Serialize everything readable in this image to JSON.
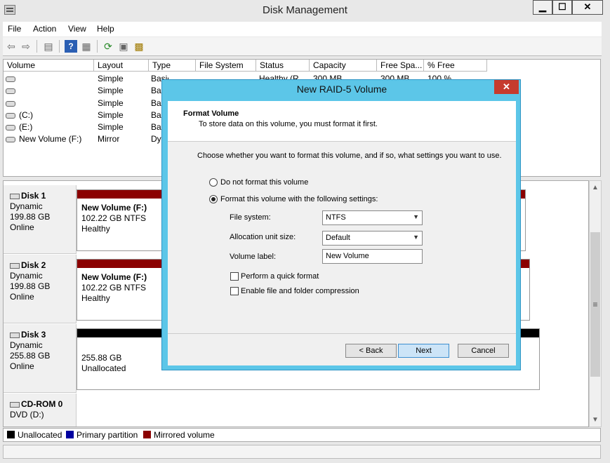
{
  "window": {
    "title": "Disk Management",
    "minimize": "▁",
    "maximize": "☐",
    "close": "✕"
  },
  "menu": [
    "File",
    "Action",
    "View",
    "Help"
  ],
  "volume_table": {
    "columns": [
      "Volume",
      "Layout",
      "Type",
      "File System",
      "Status",
      "Capacity",
      "Free Spa...",
      "% Free"
    ],
    "first_row": {
      "type": "Basic",
      "status": "Healthy (R...",
      "capacity": "300 MB",
      "free": "300 MB",
      "pct": "100 %"
    },
    "rows": [
      {
        "volume": "",
        "layout": "Simple",
        "type": "Ba"
      },
      {
        "volume": "",
        "layout": "Simple",
        "type": "Ba"
      },
      {
        "volume": "(C:)",
        "layout": "Simple",
        "type": "Ba"
      },
      {
        "volume": "(E:)",
        "layout": "Simple",
        "type": "Ba"
      },
      {
        "volume": "New Volume (F:)",
        "layout": "Mirror",
        "type": "Dy"
      },
      {
        "volume": "",
        "layout": "Simple",
        "type": "Basic"
      }
    ]
  },
  "disks": [
    {
      "name": "Disk 1",
      "kind": "Dynamic",
      "size": "199.88 GB",
      "state": "Online",
      "partition": {
        "name": "New Volume  (F:)",
        "size": "102.22 GB NTFS",
        "status": "Healthy"
      }
    },
    {
      "name": "Disk 2",
      "kind": "Dynamic",
      "size": "199.88 GB",
      "state": "Online",
      "partition": {
        "name": "New Volume  (F:)",
        "size": "102.22 GB NTFS",
        "status": "Healthy"
      }
    },
    {
      "name": "Disk 3",
      "kind": "Dynamic",
      "size": "255.88 GB",
      "state": "Online",
      "partition": {
        "size": "255.88 GB",
        "status": "Unallocated"
      }
    },
    {
      "name": "CD-ROM 0",
      "kind": "DVD (D:)"
    }
  ],
  "legend": [
    {
      "label": "Unallocated",
      "color": "#000000"
    },
    {
      "label": "Primary partition",
      "color": "#0000a0"
    },
    {
      "label": "Mirrored volume",
      "color": "#8b0000"
    }
  ],
  "dialog": {
    "title": "New RAID-5 Volume",
    "close": "✕",
    "header_title": "Format Volume",
    "header_subtitle": "To store data on this volume, you must format it first.",
    "instruction": "Choose whether you want to format this volume, and if so, what settings you want to use.",
    "option_no_format": "Do not format this volume",
    "option_format": "Format this volume with the following settings:",
    "file_system_label": "File system:",
    "file_system_value": "NTFS",
    "allocation_label": "Allocation unit size:",
    "allocation_value": "Default",
    "volume_label_label": "Volume label:",
    "volume_label_value": "New Volume",
    "quick_format": "Perform a quick format",
    "compression": "Enable file and folder compression",
    "back": "< Back",
    "next": "Next",
    "cancel": "Cancel"
  }
}
